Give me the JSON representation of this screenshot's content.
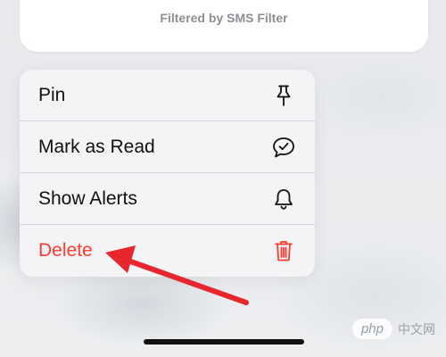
{
  "notification": {
    "filter_text": "Filtered by SMS Filter"
  },
  "context_menu": {
    "items": [
      {
        "label": "Pin",
        "icon": "pin-icon"
      },
      {
        "label": "Mark as Read",
        "icon": "message-check-icon"
      },
      {
        "label": "Show Alerts",
        "icon": "bell-icon"
      },
      {
        "label": "Delete",
        "icon": "trash-icon",
        "destructive": true
      }
    ]
  },
  "watermark": {
    "logo": "php",
    "site": "中文网"
  },
  "colors": {
    "destructive": "#ff3b30",
    "annotation_arrow": "#e8262d"
  }
}
